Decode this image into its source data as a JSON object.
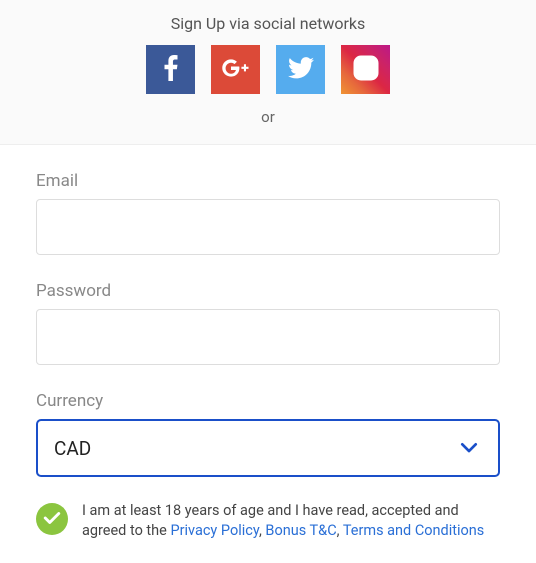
{
  "social": {
    "heading": "Sign Up via social networks",
    "or": "or"
  },
  "form": {
    "email": {
      "label": "Email",
      "value": ""
    },
    "password": {
      "label": "Password",
      "value": ""
    },
    "currency": {
      "label": "Currency",
      "selected": "CAD"
    }
  },
  "consent": {
    "text_before": "I am at least 18 years of age and I have read, accepted and agreed to the ",
    "privacy": "Privacy Policy",
    "sep1": ", ",
    "bonus": "Bonus T&C",
    "sep2": ", ",
    "terms": "Terms and Conditions",
    "checked": true
  },
  "colors": {
    "accent": "#1a4fc9",
    "link": "#2a6fd6",
    "check": "#8bc53f"
  }
}
